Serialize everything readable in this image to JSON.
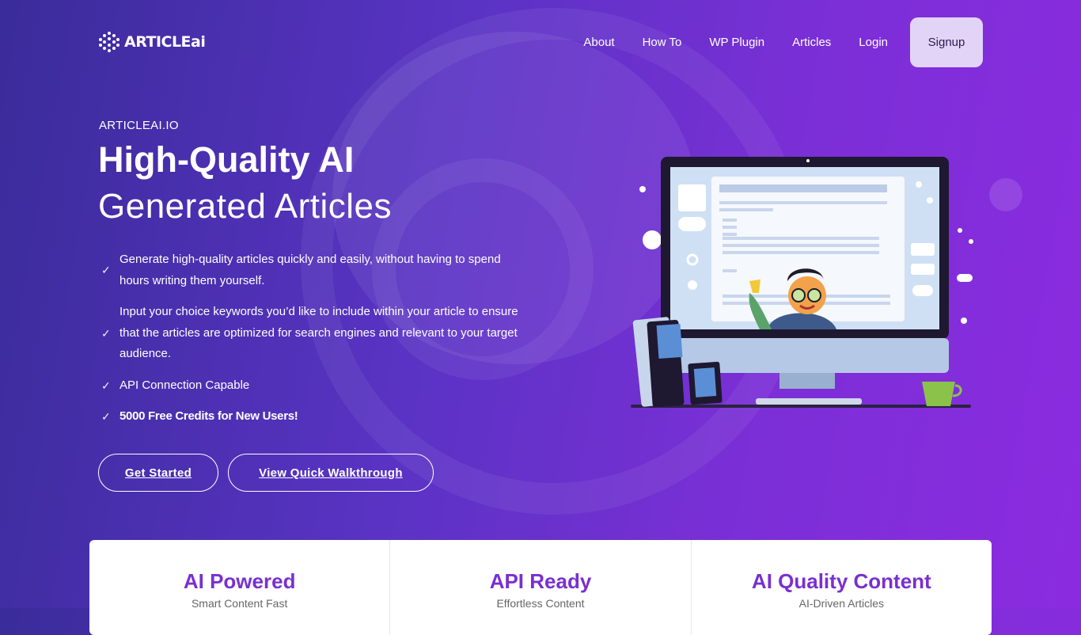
{
  "brand": {
    "logo_text": "ARTICLEai"
  },
  "nav": {
    "items": [
      {
        "label": "About"
      },
      {
        "label": "How To"
      },
      {
        "label": "WP Plugin"
      },
      {
        "label": "Articles"
      },
      {
        "label": "Login"
      }
    ],
    "signup_label": "Signup"
  },
  "hero": {
    "eyebrow": "ARTICLEAI.IO",
    "title_line1": "High-Quality AI",
    "title_line2": "Generated Articles",
    "features": [
      {
        "text": "Generate high-quality articles quickly and easily, without having to spend hours writing them yourself."
      },
      {
        "text": "Input your choice keywords you’d like to include within your article to ensure that the articles are optimized for search engines and relevant to your target audience."
      },
      {
        "text": "API Connection Capable"
      },
      {
        "text": "5000 Free Credits for New Users!"
      }
    ],
    "check_icon": "✓",
    "get_started_label": "Get Started",
    "walkthrough_label": "View Quick Walkthrough"
  },
  "stats": [
    {
      "title": "AI Powered",
      "subtitle": "Smart Content Fast"
    },
    {
      "title": "API Ready",
      "subtitle": "Effortless Content"
    },
    {
      "title": "AI Quality Content",
      "subtitle": "AI-Driven Articles"
    }
  ],
  "colors": {
    "bg_start": "#3a2c9a",
    "bg_end": "#8b2be0",
    "signup_bg": "#e2d4f6",
    "stat_title": "#7a2fd0"
  }
}
